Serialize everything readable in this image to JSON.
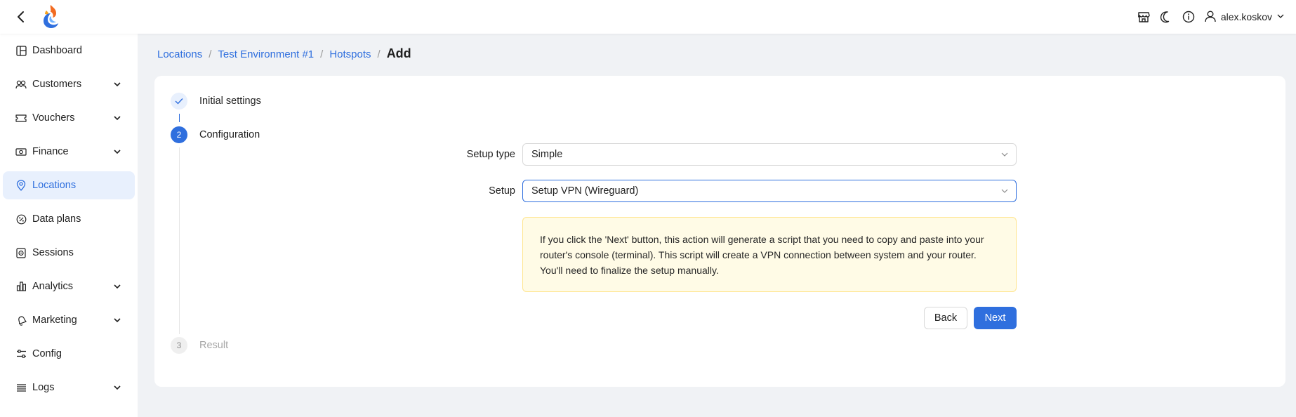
{
  "header": {
    "user_name": "alex.koskov",
    "icons": [
      "back-arrow-icon",
      "app-logo",
      "storefront-icon",
      "moon-icon",
      "info-icon",
      "user-icon",
      "chevron-down-icon"
    ]
  },
  "sidebar": {
    "items": [
      {
        "label": "Dashboard",
        "icon": "dashboard-icon",
        "has_submenu": false
      },
      {
        "label": "Customers",
        "icon": "customers-icon",
        "has_submenu": true
      },
      {
        "label": "Vouchers",
        "icon": "voucher-icon",
        "has_submenu": true
      },
      {
        "label": "Finance",
        "icon": "money-icon",
        "has_submenu": true
      },
      {
        "label": "Locations",
        "icon": "location-pin-icon",
        "has_submenu": false,
        "active": true
      },
      {
        "label": "Data plans",
        "icon": "data-plan-icon",
        "has_submenu": false
      },
      {
        "label": "Sessions",
        "icon": "sessions-icon",
        "has_submenu": false
      },
      {
        "label": "Analytics",
        "icon": "bar-chart-icon",
        "has_submenu": true
      },
      {
        "label": "Marketing",
        "icon": "bell-icon",
        "has_submenu": true
      },
      {
        "label": "Config",
        "icon": "sliders-icon",
        "has_submenu": false
      },
      {
        "label": "Logs",
        "icon": "list-icon",
        "has_submenu": true
      }
    ]
  },
  "breadcrumb": {
    "items": [
      "Locations",
      "Test Environment #1",
      "Hotspots"
    ],
    "separator": "/",
    "current": "Add"
  },
  "steps": [
    {
      "number": "1",
      "label": "Initial settings",
      "status": "done"
    },
    {
      "number": "2",
      "label": "Configuration",
      "status": "current"
    },
    {
      "number": "3",
      "label": "Result",
      "status": "waiting"
    }
  ],
  "form": {
    "setup_type_label": "Setup type",
    "setup_type_value": "Simple",
    "setup_label": "Setup",
    "setup_value": "Setup VPN (Wireguard)",
    "alert_lines": [
      "If you click the 'Next' button, this action will generate a script that you need to copy and paste into your",
      "router's console (terminal). This script will create a VPN connection between system and your router.",
      "You'll need to finalize the setup manually."
    ],
    "back_label": "Back",
    "next_label": "Next"
  },
  "colors": {
    "accent": "#2f6fde",
    "active_bg": "#e8f0fd",
    "alert_bg": "#fffbe6",
    "alert_border": "#ffe58f",
    "page_bg": "#f0f2f5"
  }
}
